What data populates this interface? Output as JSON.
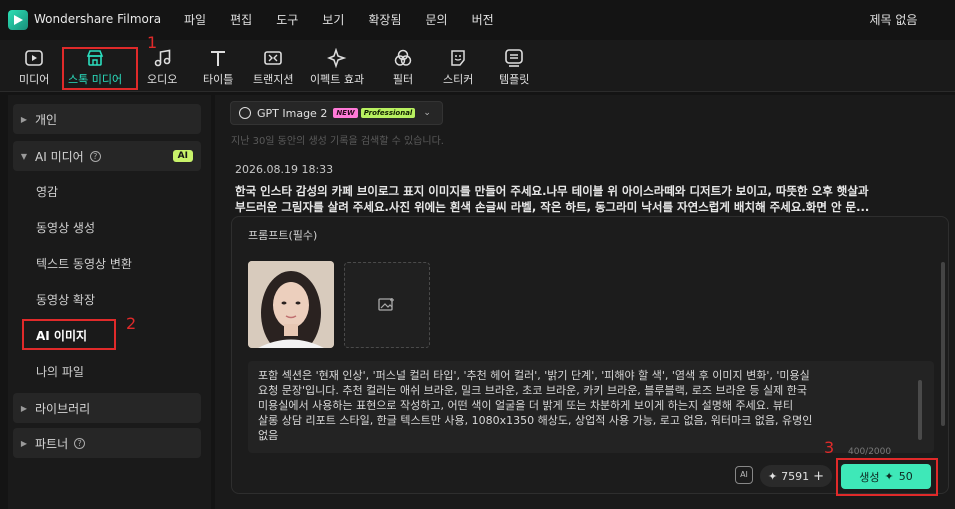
{
  "app": {
    "title": "Wondershare Filmora",
    "project": "제목 없음"
  },
  "menu": [
    "파일",
    "편집",
    "도구",
    "보기",
    "확장됨",
    "문의",
    "버전"
  ],
  "toolbar": {
    "items": [
      {
        "label": "미디어",
        "icon": "media-icon"
      },
      {
        "label": "스톡 미디어",
        "icon": "stock-media-icon"
      },
      {
        "label": "오디오",
        "icon": "music-note-icon"
      },
      {
        "label": "타이틀",
        "icon": "title-t-icon"
      },
      {
        "label": "트랜지션",
        "icon": "transition-icon"
      },
      {
        "label": "이펙트 효과",
        "icon": "effects-sparkle-icon"
      },
      {
        "label": "필터",
        "icon": "filter-icon"
      },
      {
        "label": "스티커",
        "icon": "sticker-icon"
      },
      {
        "label": "템플릿",
        "icon": "template-icon"
      }
    ]
  },
  "annotations": {
    "n1": "1",
    "n2": "2",
    "n3": "3",
    "color": "#e02a2a"
  },
  "sidebar": {
    "groups": {
      "personal": "개인",
      "ai_media": "AI 미디어",
      "ai_badge": "AI",
      "library": "라이브러리",
      "partner": "파트너"
    },
    "items": [
      "영감",
      "동영상 생성",
      "텍스트 동영상 변환",
      "동영상 확장",
      "AI 이미지",
      "나의 파일"
    ]
  },
  "main": {
    "model": "GPT Image 2",
    "badge_new": "NEW",
    "badge_pro": "Professional",
    "hint": "지난 30일 동안의 생성 기록을 검색할 수 있습니다.",
    "date": "2026.08.19 18:33",
    "prompt_line1": "한국 인스타 감성의 카페 브이로그 표지 이미지를 만들어 주세요.나무 테이블 위 아이스라떼와 디저트가 보이고, 따뜻한 오후 햇살과",
    "prompt_line2": "부드러운 그림자를 살려 주세요.사진 위에는 흰색 손글씨 라벨, 작은 하트, 동그라미 낙서를 자연스럽게 배치해 주세요.화면 안 문...",
    "panel_label": "프롬프트(필수)",
    "textarea": [
      "포함 섹션은 '현재 인상', '퍼스널 컬러 타입', '추천 헤어 컬러', '밝기 단계', '피해야 할 색', '염색 후 이미지 변화', '미용실",
      "요청 문장'입니다. 추천 컬러는 애쉬 브라운, 밀크 브라운, 초코 브라운, 카키 브라운, 블루블랙, 로즈 브라운 등 실제 한국",
      "미용실에서 사용하는 표현으로 작성하고, 어떤 색이 얼굴을 더 밝게 또는 차분하게 보이게 하는지 설명해 주세요. 뷰티",
      "살롱 상담 리포트 스타일, 한글 텍스트만 사용, 1080x1350 해상도, 상업적 사용 가능, 로고 없음, 워터마크 없음, 유명인",
      "없음"
    ],
    "counter": "400/2000",
    "credits": "7591",
    "generate_label": "생성",
    "generate_cost": "50",
    "accent": "#3ee8b8"
  }
}
